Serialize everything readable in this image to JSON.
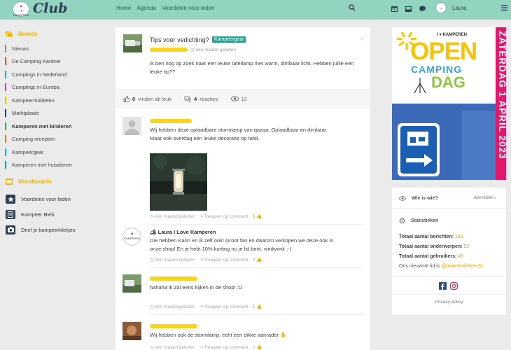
{
  "app": {
    "logo_text": "Club",
    "logo_badge": "I ♥ KAMPEREN"
  },
  "topnav": [
    "Home",
    "Agenda",
    "Voordelen voor leden"
  ],
  "user": {
    "name": "Laura"
  },
  "sidebar": {
    "boards_title": "Boards",
    "boards": [
      {
        "label": "Nieuws",
        "color": "#888888"
      },
      {
        "label": "De Camping Kantine",
        "color": "#e74c3c"
      },
      {
        "label": "Campings in Nederland",
        "color": "#3498db"
      },
      {
        "label": "Campings in Europa",
        "color": "#9b59b6"
      },
      {
        "label": "Kampeermiddelen",
        "color": "#f1c40f"
      },
      {
        "label": "Marktplaats",
        "color": "#2c3e50"
      },
      {
        "label": "Kamperen met kinderen",
        "color": "#27ae60"
      },
      {
        "label": "Camping recepten",
        "color": "#e67e22"
      },
      {
        "label": "Kampeergear",
        "color": "#1abc9c"
      },
      {
        "label": "Kamperen met huisdieren",
        "color": "#16a085"
      }
    ],
    "moodboards_title": "Moodboards",
    "moodboards": [
      {
        "label": "Voordelen voor leden"
      },
      {
        "label": "Kampeer Bieb"
      },
      {
        "label": "Deel je kampeerklekjes"
      }
    ]
  },
  "post": {
    "title": "Tips voor verlichting?",
    "tag": "Kampeergear",
    "time": "één maand geleden",
    "body": "Ik ben nog op zoek naar een leuke tafellamp met warm, dimbaar licht. Hebben jullie een leuke tip??",
    "likes_count": "0",
    "likes_label": "vinden dit leuk",
    "replies_count": "4",
    "replies_label": "reacties",
    "views": "12"
  },
  "replies": [
    {
      "text": "Wij hebben deze oplaadbare stormlamp van qazqa. Oplaadbaar en dimbaar. Maar ook overdag een leuke decoratie op tafel.",
      "time": "één maand geleden",
      "reply_label": "Reageer op comment",
      "likes": "5"
    },
    {
      "author": "Laura I Love Kamperen",
      "text": "Die hebben Karin en ik zelf ook! Groot fan en daarom verkopen we deze ook in onze shop! En je hebt 10% korting nu je lid bent, winkwink ;-)",
      "time": "één maand geleden",
      "reply_label": "Reageer op comment",
      "likes": "0"
    },
    {
      "text": "hahaha ik zal eens kijken in de shop! :D",
      "time": "één maand geleden",
      "reply_label": "Reageer op comment",
      "likes": "1"
    },
    {
      "text": "Wij hebben ook de stormlamp. echt een dikke aanrader",
      "time": "één maand geleden",
      "reply_label": "Reageer op comment",
      "likes": "2"
    }
  ],
  "promo": {
    "brand": "I ♥ KAMPEREN",
    "line1": "OPEN",
    "line2": "CAMPING",
    "line3": "DAG",
    "date": "ZATERDAG 1 APRIL 2023"
  },
  "widget": {
    "who_title": "Wie is wie?",
    "all_members": "Alle leden",
    "stats_title": "Statistieken",
    "stats": [
      {
        "label": "Totaal aantal berichten:",
        "value": "183"
      },
      {
        "label": "Totaal aantal onderwerpen:",
        "value": "52"
      },
      {
        "label": "Totaal aantal gebruikers:",
        "value": "49"
      }
    ],
    "newest_prefix": "Ons nieuwste lid is",
    "newest_user": "@maartenliebrecht",
    "privacy": "Privacy policy"
  },
  "colors": {
    "header": "#93d4c1",
    "accent": "#f0b400",
    "tag": "#2e9e8c",
    "navy": "#2d3e50"
  }
}
